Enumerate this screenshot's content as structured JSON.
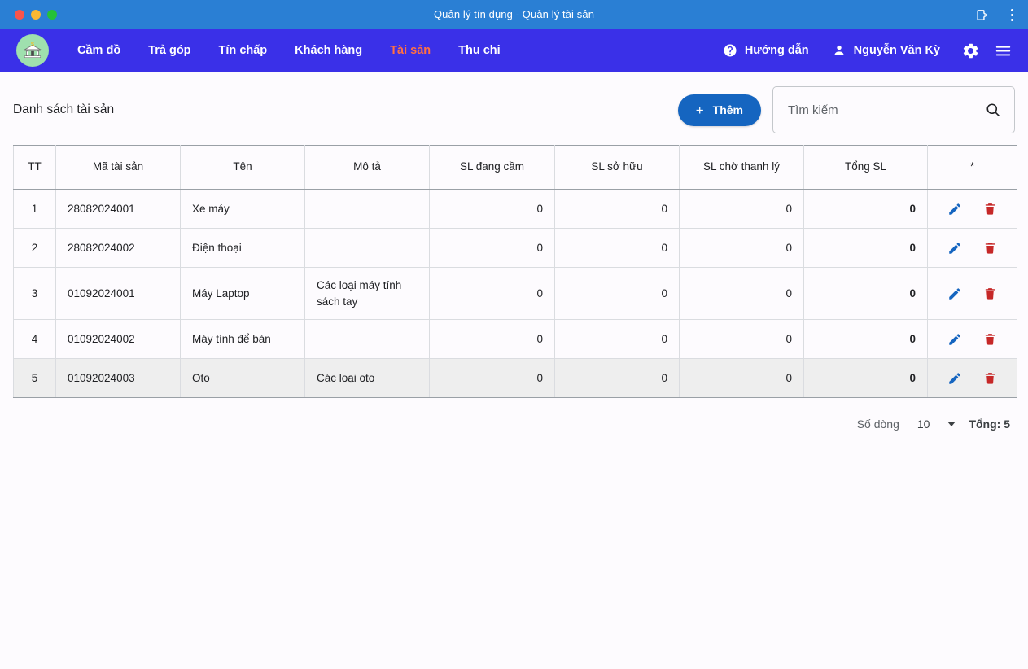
{
  "window": {
    "title": "Quản lý tín dụng - Quản lý tài sản",
    "controls": {
      "close": "close",
      "minimize": "minimize",
      "maximize": "maximize"
    },
    "right_icons": [
      {
        "name": "extensions-icon"
      },
      {
        "name": "more-vertical-icon"
      }
    ]
  },
  "navbar": {
    "logo_alt": "bank-logo",
    "links": [
      {
        "label": "Cầm đồ",
        "active": false
      },
      {
        "label": "Trả góp",
        "active": false
      },
      {
        "label": "Tín chấp",
        "active": false
      },
      {
        "label": "Khách hàng",
        "active": false
      },
      {
        "label": "Tài sản",
        "active": true
      },
      {
        "label": "Thu chi",
        "active": false
      }
    ],
    "help_label": "Hướng dẫn",
    "user_name": "Nguyễn Văn Kỳ",
    "settings_icon": "gear-icon",
    "menu_icon": "hamburger-icon",
    "active_color": "#ff7043",
    "background": "#3a30e8"
  },
  "page": {
    "title": "Danh sách tài sản",
    "add_button": "Thêm",
    "add_icon": "plus-icon",
    "search_placeholder": "Tìm kiếm",
    "search_value": "",
    "search_icon": "search-icon"
  },
  "table": {
    "columns": [
      "TT",
      "Mã tài sản",
      "Tên",
      "Mô tả",
      "SL đang cầm",
      "SL sở hữu",
      "SL chờ thanh lý",
      "Tổng SL",
      "*"
    ],
    "rows": [
      {
        "tt": "1",
        "ma": "28082024001",
        "ten": "Xe máy",
        "mota": "",
        "sl_dang_cam": "0",
        "sl_so_huu": "0",
        "sl_cho_thanh_ly": "0",
        "tong_sl": "0",
        "selected": false
      },
      {
        "tt": "2",
        "ma": "28082024002",
        "ten": "Điện thoại",
        "mota": "",
        "sl_dang_cam": "0",
        "sl_so_huu": "0",
        "sl_cho_thanh_ly": "0",
        "tong_sl": "0",
        "selected": false
      },
      {
        "tt": "3",
        "ma": "01092024001",
        "ten": "Máy Laptop",
        "mota": "Các loại máy tính sách tay",
        "sl_dang_cam": "0",
        "sl_so_huu": "0",
        "sl_cho_thanh_ly": "0",
        "tong_sl": "0",
        "selected": false
      },
      {
        "tt": "4",
        "ma": "01092024002",
        "ten": "Máy tính để bàn",
        "mota": "",
        "sl_dang_cam": "0",
        "sl_so_huu": "0",
        "sl_cho_thanh_ly": "0",
        "tong_sl": "0",
        "selected": false
      },
      {
        "tt": "5",
        "ma": "01092024003",
        "ten": "Oto",
        "mota": "Các loại oto",
        "sl_dang_cam": "0",
        "sl_so_huu": "0",
        "sl_cho_thanh_ly": "0",
        "tong_sl": "0",
        "selected": true
      }
    ],
    "row_actions": {
      "edit_icon": "pencil-icon",
      "delete_icon": "trash-icon"
    }
  },
  "footer": {
    "rows_label": "Số dòng",
    "rows_value": "10",
    "total_label": "Tổng: 5"
  }
}
